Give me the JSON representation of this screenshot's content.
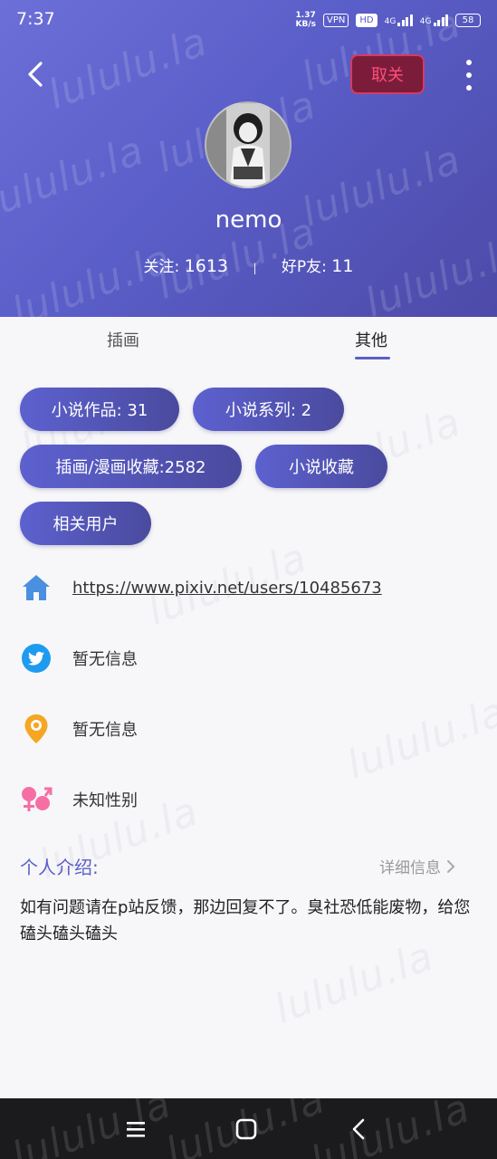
{
  "status_bar": {
    "time": "7:37",
    "net_speed_value": "1.37",
    "net_speed_unit": "KB/s",
    "vpn": "VPN",
    "hd": "HD",
    "sim1": "4G",
    "sim2": "4G",
    "battery": "58"
  },
  "watermark": "lululu.la",
  "header": {
    "unfollow_label": "取关",
    "username": "nemo",
    "following_label": "关注:",
    "following_count": "1613",
    "separator": "|",
    "friends_label": "好P友:",
    "friends_count": "11"
  },
  "tabs": [
    {
      "label": "插画"
    },
    {
      "label": "其他"
    }
  ],
  "chips": [
    {
      "label": "小说作品: 31"
    },
    {
      "label": "小说系列: 2"
    },
    {
      "label": "插画/漫画收藏:2582"
    },
    {
      "label": "小说收藏"
    },
    {
      "label": "相关用户"
    }
  ],
  "info": {
    "homepage": "https://www.pixiv.net/users/10485673",
    "twitter": "暂无信息",
    "location": "暂无信息",
    "gender": "未知性别"
  },
  "intro": {
    "title": "个人介绍:",
    "detail_label": "详细信息",
    "text": "如有问题请在p站反馈，那边回复不了。臭社恐低能废物，给您磕头磕头磕头"
  },
  "colors": {
    "accent": "#5b5fc7",
    "unfollow": "#ff4d7a",
    "home_icon": "#4a8fe0",
    "twitter_icon": "#1d9bf0",
    "location_icon": "#f5a623",
    "gender_icon": "#f56fa5"
  },
  "icons": [
    "back-icon",
    "more-icon",
    "home-icon",
    "twitter-icon",
    "location-icon",
    "gender-icon",
    "chevron-right-icon",
    "menu-icon",
    "home-nav-icon",
    "back-nav-icon"
  ]
}
